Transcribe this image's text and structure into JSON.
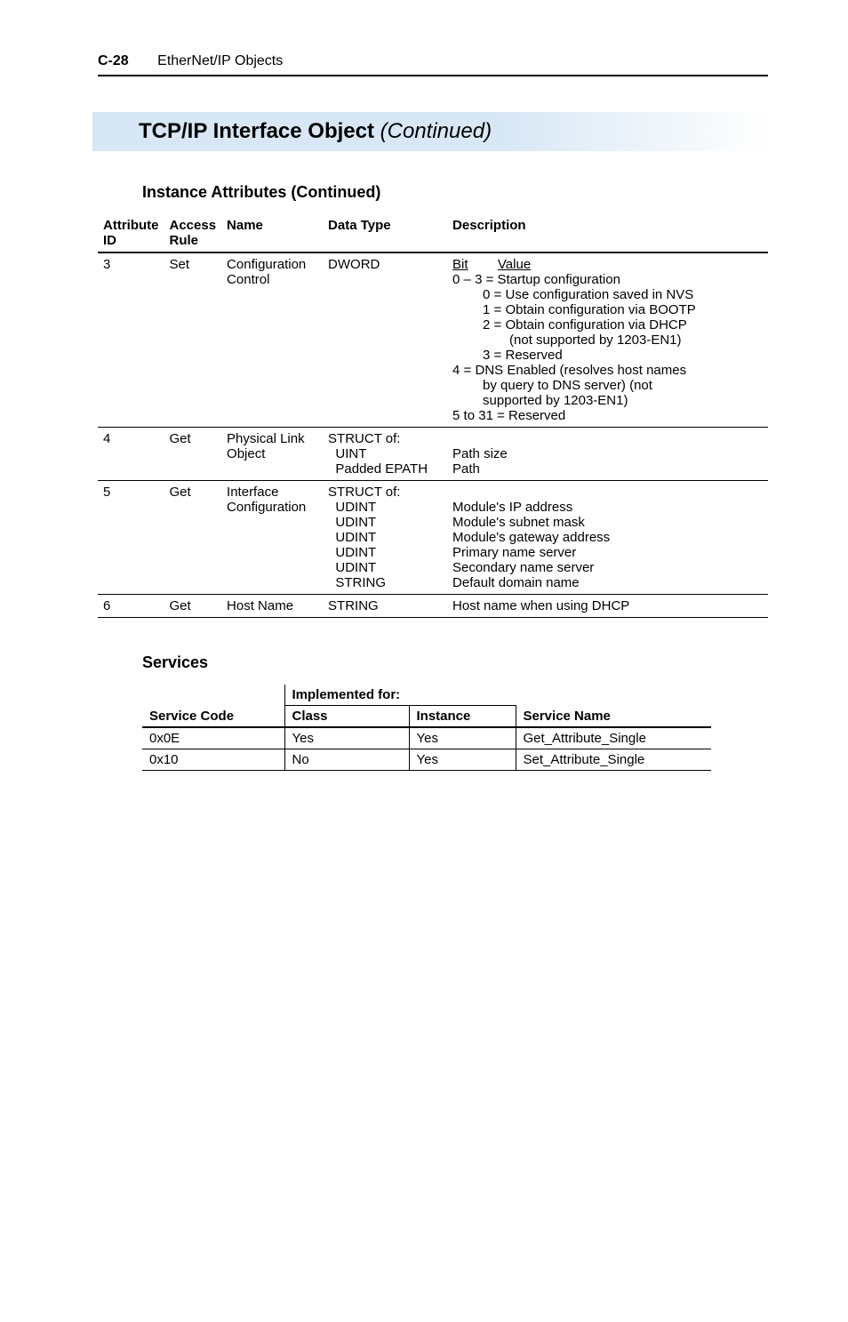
{
  "header": {
    "page_number": "C-28",
    "section": "EtherNet/IP Objects"
  },
  "title": {
    "main": "TCP/IP Interface Object",
    "continued": "(Continued)"
  },
  "instance_attributes": {
    "heading": "Instance Attributes (Continued)",
    "columns": {
      "attr_id": "Attribute ID",
      "access_rule": "Access Rule",
      "name": "Name",
      "data_type": "Data Type",
      "description": "Description"
    },
    "rows": [
      {
        "attr_id": "3",
        "access_rule": "Set",
        "name": "Configuration Control",
        "data_type": "DWORD",
        "description": {
          "bit_label": "Bit",
          "value_label": "Value",
          "lines": [
            "0 – 3 = Startup configuration",
            "0 = Use configuration saved in NVS",
            "1 = Obtain configuration via BOOTP",
            "2 = Obtain configuration via DHCP",
            "(not supported by 1203-EN1)",
            "3 = Reserved",
            "4 = DNS Enabled (resolves host names",
            "by query to DNS server) (not",
            "supported by 1203-EN1)",
            "5 to 31 = Reserved"
          ]
        }
      },
      {
        "attr_id": "4",
        "access_rule": "Get",
        "name": "Physical Link Object",
        "data_type": "STRUCT of:\n  UINT\n  Padded EPATH",
        "description": "\nPath size\nPath"
      },
      {
        "attr_id": "5",
        "access_rule": "Get",
        "name": "Interface Configuration",
        "data_type": "STRUCT of:\n  UDINT\n  UDINT\n  UDINT\n  UDINT\n  UDINT\n  STRING",
        "description": "\nModule's IP address\nModule's subnet mask\nModule's gateway address\nPrimary name server\nSecondary name server\nDefault domain name"
      },
      {
        "attr_id": "6",
        "access_rule": "Get",
        "name": "Host Name",
        "data_type": "STRING",
        "description": "Host name when using DHCP"
      }
    ]
  },
  "services": {
    "heading": "Services",
    "group_header": "Implemented for:",
    "columns": {
      "service_code": "Service Code",
      "class": "Class",
      "instance": "Instance",
      "service_name": "Service Name"
    },
    "rows": [
      {
        "service_code": "0x0E",
        "class": "Yes",
        "instance": "Yes",
        "service_name": "Get_Attribute_Single"
      },
      {
        "service_code": "0x10",
        "class": "No",
        "instance": "Yes",
        "service_name": "Set_Attribute_Single"
      }
    ]
  }
}
